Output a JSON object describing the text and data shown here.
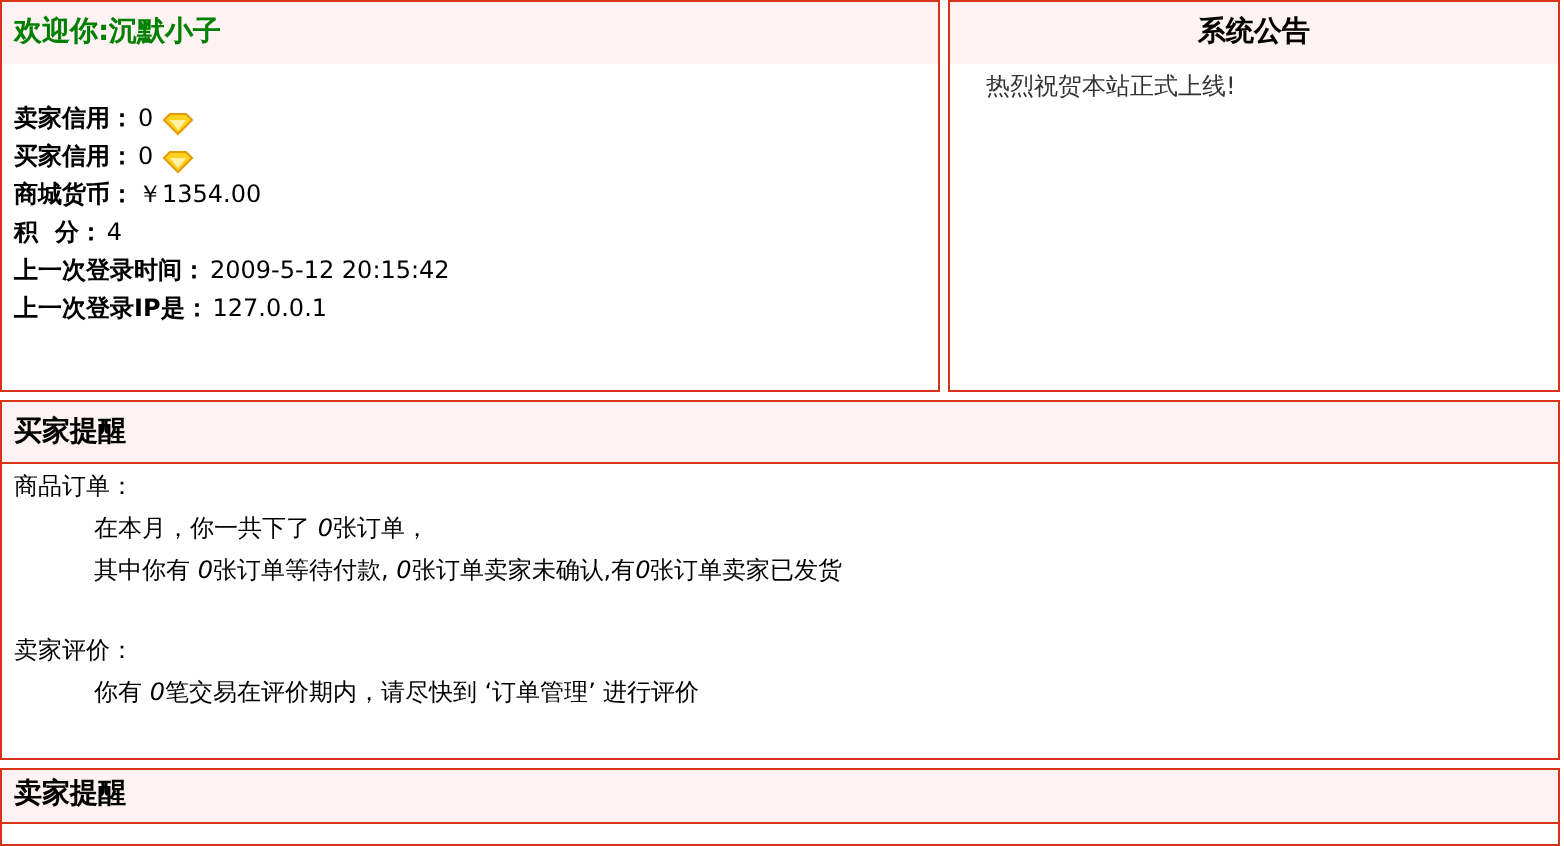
{
  "welcome": {
    "title": "欢迎你:沉默小子",
    "fields": [
      {
        "label": "卖家信用：",
        "value": "0",
        "kind": "rating"
      },
      {
        "label": "买家信用：",
        "value": "0",
        "kind": "rating"
      },
      {
        "label": "商城货币：",
        "value": "￥1354.00",
        "kind": "plain"
      },
      {
        "label": "积  分：",
        "value": "4",
        "kind": "plain"
      },
      {
        "label": "上一次登录时间：",
        "value": "2009-5-12 20:15:42",
        "kind": "plain"
      },
      {
        "label": "上一次登录IP是：",
        "value": "127.0.0.1",
        "kind": "plain"
      }
    ]
  },
  "announcement": {
    "title": "系统公告",
    "items": [
      "热烈祝贺本站正式上线!"
    ]
  },
  "buyer_reminder": {
    "title": "买家提醒",
    "sections": [
      {
        "heading": "商品订单：",
        "lines": [
          [
            {
              "text": "在本月，你一共下了 ",
              "italic": false
            },
            {
              "text": "0",
              "italic": true
            },
            {
              "text": "张订单，",
              "italic": false
            }
          ],
          [
            {
              "text": "其中你有 ",
              "italic": false
            },
            {
              "text": "0",
              "italic": true
            },
            {
              "text": "张订单等待付款, ",
              "italic": false
            },
            {
              "text": "0",
              "italic": true
            },
            {
              "text": "张订单卖家未确认,有",
              "italic": false
            },
            {
              "text": "0",
              "italic": true
            },
            {
              "text": "张订单卖家已发货",
              "italic": false
            }
          ]
        ]
      },
      {
        "heading": "卖家评价：",
        "lines": [
          [
            {
              "text": "你有 ",
              "italic": false
            },
            {
              "text": "0",
              "italic": true
            },
            {
              "text": "笔交易在评价期内，请尽快到 ‘订单管理’ 进行评价",
              "italic": false
            }
          ]
        ]
      }
    ]
  },
  "seller_reminder": {
    "title": "卖家提醒"
  }
}
